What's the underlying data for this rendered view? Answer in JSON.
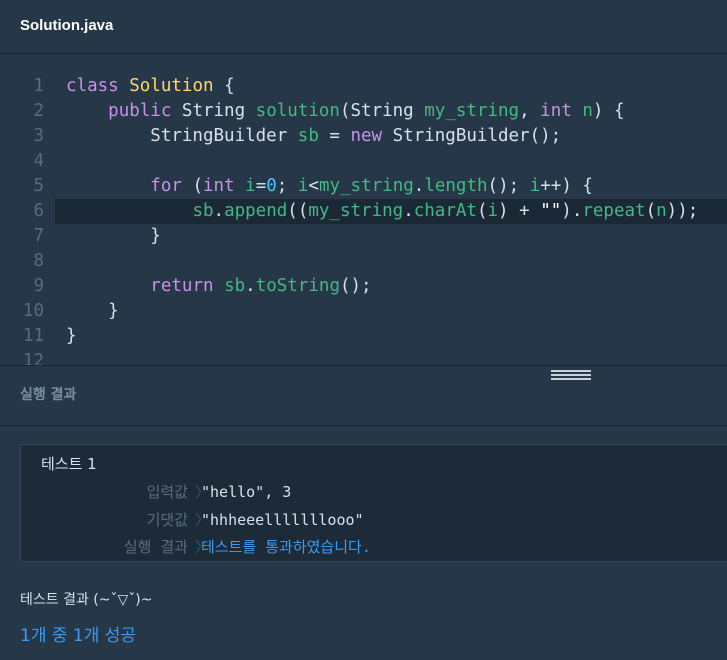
{
  "file": {
    "title": "Solution.java"
  },
  "editor": {
    "active_line": 6,
    "lines": [
      {
        "n": "1",
        "html": "<span class=\"kw\">class</span> <span class=\"cls\">Solution</span> {"
      },
      {
        "n": "2",
        "html": "    <span class=\"kw\">public</span> String <span class=\"fn\">solution</span>(String <span class=\"fn\">my_string</span>, <span class=\"kw\">int</span> <span class=\"fn\">n</span>) {"
      },
      {
        "n": "3",
        "html": "        StringBuilder <span class=\"fn\">sb</span> = <span class=\"kw\">new</span> StringBuilder();"
      },
      {
        "n": "4",
        "html": ""
      },
      {
        "n": "5",
        "html": "        <span class=\"kw\">for</span> (<span class=\"kw\">int</span> <span class=\"fn\">i</span>=<span class=\"num\">0</span>; <span class=\"fn\">i</span>&lt;<span class=\"fn\">my_string</span>.<span class=\"fn\">length</span>(); <span class=\"fn\">i</span>++) {"
      },
      {
        "n": "6",
        "html": "            <span class=\"fn\">sb</span>.<span class=\"fn\">append</span>((<span class=\"fn\">my_string</span>.<span class=\"fn\">charAt</span>(<span class=\"fn\">i</span>) + <span class=\"str\">\"\"</span>).<span class=\"fn\">repeat</span>(<span class=\"fn\">n</span>));"
      },
      {
        "n": "7",
        "html": "        }"
      },
      {
        "n": "8",
        "html": ""
      },
      {
        "n": "9",
        "html": "        <span class=\"kw\">return</span> <span class=\"fn\">sb</span>.<span class=\"fn\">toString</span>();"
      },
      {
        "n": "10",
        "html": "    }"
      },
      {
        "n": "11",
        "html": "}"
      },
      {
        "n": "12",
        "html": ""
      }
    ]
  },
  "results": {
    "title": "실행 결과",
    "test": {
      "name": "테스트 1",
      "rows": [
        {
          "label": "입력값",
          "sep": "〉",
          "value": "\"hello\", 3"
        },
        {
          "label": "기댓값",
          "sep": "〉",
          "value": "\"hhheeelllllllooo\""
        },
        {
          "label": "실행 결과",
          "sep": "〉",
          "value": "테스트를 통과하였습니다."
        }
      ]
    },
    "summary_title": "테스트 결과 (~ˇ▽ˇ)~",
    "summary_result": "1개 중 1개 성공"
  },
  "colors": {
    "background": "#263747",
    "pass": "#3b9af3",
    "keyword": "#c792ea",
    "identifier": "#43b983",
    "class": "#ffd866"
  }
}
